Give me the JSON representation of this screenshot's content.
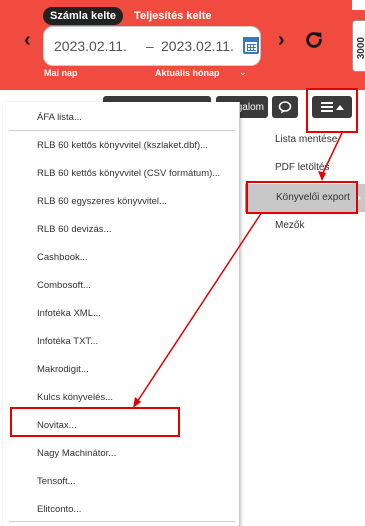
{
  "header": {
    "tabs": [
      {
        "label": "Számla kelte",
        "active": true
      },
      {
        "label": "Teljesítés kelte",
        "active": false
      }
    ],
    "date_from": "2023.02.11.",
    "date_separator": "–",
    "date_to": "2023.02.11.",
    "quick_today": "Mai nap",
    "quick_month": "Aktuális hónap",
    "side_widget": "3000",
    "background_color": "#f04b3e"
  },
  "toolbar": {
    "forgalom_label": "galom",
    "icons": [
      "chat-icon",
      "list-icon",
      "caret-up-icon"
    ]
  },
  "right_menu": {
    "items": [
      {
        "label": "Lista mentése"
      },
      {
        "label": "PDF letöltés"
      },
      {
        "label": "Könyvelői export",
        "active": true
      },
      {
        "label": "Mezők"
      }
    ]
  },
  "export_menu": {
    "items": [
      "ÁFA lista...",
      "RLB 60 kettős könyvvitel (kszlaket.dbf)...",
      "RLB 60 kettős könyvvitel (CSV formátum)...",
      "RLB 60 egyszeres könyvvitel...",
      "RLB 60 devizás...",
      "Cashbook...",
      "Combosoft...",
      "Infotéka XML...",
      "Infotéka TXT...",
      "Makrodigit...",
      "Kulcs könyvelés...",
      "Novitax...",
      "Nagy Machinátor...",
      "Tensoft...",
      "Elitconto..."
    ],
    "highlighted_item": "Novitax..."
  },
  "annotation_color": "#e30000"
}
